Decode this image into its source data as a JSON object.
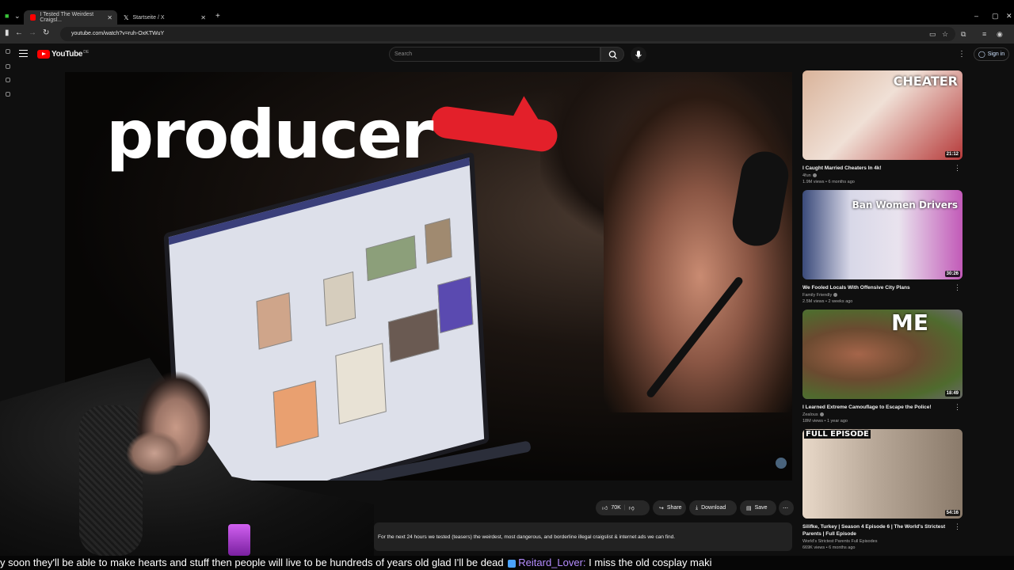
{
  "browser": {
    "tabs": [
      {
        "label": "I Tested The Weirdest Craigsl...",
        "active": true
      },
      {
        "label": "Startseite / X",
        "active": false
      }
    ],
    "url": "youtube.com/watch?v=ruh-OxKTWuY"
  },
  "youtube": {
    "logo_text": "YouTube",
    "region": "DE",
    "search_placeholder": "Search",
    "signin_label": "Sign in"
  },
  "video": {
    "thumbnail_text": "producer"
  },
  "actions": {
    "likes": "70K",
    "share": "Share",
    "download": "Download",
    "save": "Save"
  },
  "description": "For the next 24 hours we tested (teasers) the weirdest, most dangerous, and borderline illegal craigslist & internet ads we can find.",
  "recommendations": [
    {
      "thumb_caption": "CHEATER",
      "duration": "21:12",
      "title": "I Caught Married Cheaters In 4k!",
      "channel": "4fun",
      "meta": "1.9M views • 6 months ago",
      "bg": "#c9a58a"
    },
    {
      "thumb_caption": "Ban Women Drivers",
      "duration": "30:26",
      "title": "We Fooled Locals With Offensive City Plans",
      "channel": "Family Friendly",
      "meta": "2.5M views • 2 weeks ago",
      "bg": "#5b6e8a"
    },
    {
      "thumb_caption": "ME",
      "duration": "18:49",
      "title": "I Learned Extreme Camouflage to Escape the Police!",
      "channel": "Zealous",
      "meta": "18M views • 1 year ago",
      "bg": "#5a7a3a"
    },
    {
      "thumb_caption": "FULL EPISODE",
      "duration": "54:16",
      "title": "Silifke, Turkey | Season 4 Episode 6 | The World's Strictest Parents | Full Episode",
      "channel": "World's Strictest Parents Full Episodes",
      "meta": "669K views • 6 months ago",
      "bg": "#b7a492"
    }
  ],
  "chat": {
    "before": "y soon they'll be able to make hearts and stuff then people will live to be hundreds of years old glad I'll be dead",
    "username": "Reitard_Lover:",
    "message": "I miss the old cosplay maki"
  }
}
